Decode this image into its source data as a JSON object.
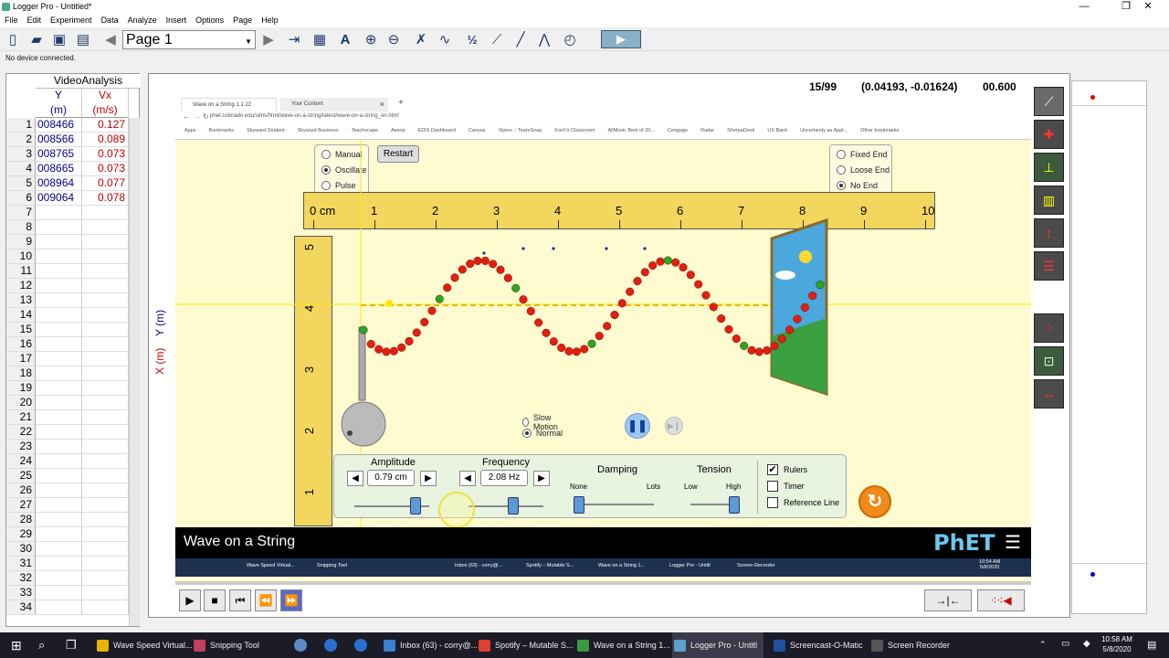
{
  "window": {
    "title": "Logger Pro - Untitled*",
    "min": "—",
    "max": "❐",
    "close": "✕"
  },
  "menu": [
    "File",
    "Edit",
    "Experiment",
    "Data",
    "Analyze",
    "Insert",
    "Options",
    "Page",
    "Help"
  ],
  "toolbar": {
    "page_select": "Page 1",
    "fraction_icon": "½"
  },
  "status": {
    "device": "No device connected."
  },
  "table": {
    "dataset": "VideoAnalysis",
    "columns": [
      {
        "name": "Y",
        "unit": "(m)"
      },
      {
        "name": "Vx",
        "unit": "(m/s)"
      }
    ],
    "rows": [
      {
        "n": "1",
        "y": "008466",
        "vx": "0.127"
      },
      {
        "n": "2",
        "y": "008566",
        "vx": "0.089"
      },
      {
        "n": "3",
        "y": "008765",
        "vx": "0.073"
      },
      {
        "n": "4",
        "y": "008665",
        "vx": "0.073"
      },
      {
        "n": "5",
        "y": "008964",
        "vx": "0.077"
      },
      {
        "n": "6",
        "y": "009064",
        "vx": "0.078"
      },
      {
        "n": "7",
        "y": "",
        "vx": ""
      },
      {
        "n": "8",
        "y": "",
        "vx": ""
      },
      {
        "n": "9",
        "y": "",
        "vx": ""
      },
      {
        "n": "10",
        "y": "",
        "vx": ""
      },
      {
        "n": "11",
        "y": "",
        "vx": ""
      },
      {
        "n": "12",
        "y": "",
        "vx": ""
      },
      {
        "n": "13",
        "y": "",
        "vx": ""
      },
      {
        "n": "14",
        "y": "",
        "vx": ""
      },
      {
        "n": "15",
        "y": "",
        "vx": ""
      },
      {
        "n": "16",
        "y": "",
        "vx": ""
      },
      {
        "n": "17",
        "y": "",
        "vx": ""
      },
      {
        "n": "18",
        "y": "",
        "vx": ""
      },
      {
        "n": "19",
        "y": "",
        "vx": ""
      },
      {
        "n": "20",
        "y": "",
        "vx": ""
      },
      {
        "n": "21",
        "y": "",
        "vx": ""
      },
      {
        "n": "22",
        "y": "",
        "vx": ""
      },
      {
        "n": "23",
        "y": "",
        "vx": ""
      },
      {
        "n": "24",
        "y": "",
        "vx": ""
      },
      {
        "n": "25",
        "y": "",
        "vx": ""
      },
      {
        "n": "26",
        "y": "",
        "vx": ""
      },
      {
        "n": "27",
        "y": "",
        "vx": ""
      },
      {
        "n": "28",
        "y": "",
        "vx": ""
      },
      {
        "n": "29",
        "y": "",
        "vx": ""
      },
      {
        "n": "30",
        "y": "",
        "vx": ""
      },
      {
        "n": "31",
        "y": "",
        "vx": ""
      },
      {
        "n": "32",
        "y": "",
        "vx": ""
      },
      {
        "n": "33",
        "y": "",
        "vx": ""
      },
      {
        "n": "34",
        "y": "",
        "vx": ""
      }
    ]
  },
  "video": {
    "frame": "15/99",
    "coords": "(0.04193, -0.01624)",
    "time": "00.600",
    "axis_x_label": "X (m)",
    "axis_y_label": "Y (m)"
  },
  "browser": {
    "tab1": "Wave on a String 1.1.22",
    "tab2": "Your Content",
    "tab_close": "×",
    "new_tab": "+",
    "url": "phet.colorado.edu/sims/html/wave-on-a-string/latest/wave-on-a-string_en.html",
    "bookmarks": [
      "Apps",
      "Bookmarks",
      "Skyward Student",
      "Skyward Business",
      "Teachscape",
      "Aesop",
      "EDIS Dashboard",
      "Canvas",
      "Vipers :: TeamSnap",
      "Koch's Classroom",
      "AllMusic Best of 20...",
      "Cengage",
      "Radar",
      "SherpaDesk",
      "US Bank",
      "Uncertainty as Appl...",
      "Other bookmarks"
    ]
  },
  "sim": {
    "mode": {
      "options": [
        "Manual",
        "Oscillate",
        "Pulse"
      ],
      "selected": 1
    },
    "restart": "Restart",
    "end": {
      "options": [
        "Fixed End",
        "Loose End",
        "No End"
      ],
      "selected": 2
    },
    "ruler_h_labels": [
      "0 cm",
      "1",
      "2",
      "3",
      "4",
      "5",
      "6",
      "7",
      "8",
      "9",
      "10"
    ],
    "ruler_v_labels": [
      "5",
      "4",
      "3",
      "2",
      "1"
    ],
    "speed": {
      "options": [
        "Slow Motion",
        "Normal"
      ],
      "selected": 1
    },
    "amplitude": {
      "label": "Amplitude",
      "value": "0.79 cm",
      "level": 0.48
    },
    "frequency": {
      "label": "Frequency",
      "value": "2.08 Hz",
      "level": 0.6
    },
    "damping": {
      "label": "Damping",
      "min": "None",
      "max": "Lots",
      "level": 0.0
    },
    "tension": {
      "label": "Tension",
      "min": "Low",
      "max": "High",
      "level": 1.0
    },
    "checkboxes": [
      {
        "label": "Rulers",
        "checked": true
      },
      {
        "label": "Timer",
        "checked": false
      },
      {
        "label": "Reference Line",
        "checked": false
      }
    ],
    "title": "Wave on a String",
    "logo": "PhET"
  },
  "inner_taskbar": {
    "items": [
      "Wave Speed Virtual...",
      "Snipping Tool",
      "Inbox (63) - corry@...",
      "Spotify – Mutable S...",
      "Wave on a String 1...",
      "Logger Pro - Untitl",
      "Screen Recorder"
    ],
    "clock_time": "10:54 AM",
    "clock_date": "5/8/2020"
  },
  "taskbar": {
    "items": [
      "Wave Speed Virtual...",
      "Snipping Tool",
      "Inbox (63) - corry@...",
      "Spotify – Mutable S...",
      "Wave on a String 1...",
      "Logger Pro - Untitl",
      "Screencast-O-Matic",
      "Screen Recorder"
    ],
    "time": "10:58 AM",
    "date": "5/8/2020"
  },
  "colors": {
    "sim_bg": "#fffbd0",
    "ruler": "#f2d65e",
    "bead_red": "#e02010",
    "bead_green": "#22aa22",
    "accent_blue": "#00008b",
    "accent_red": "#c00000"
  }
}
